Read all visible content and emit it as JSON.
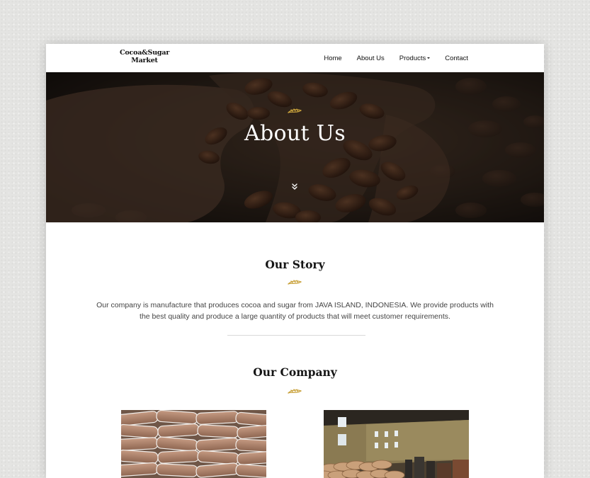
{
  "brand": {
    "logo_line1": "Cocoa&Sugar",
    "logo_line2": "Market"
  },
  "nav": {
    "items": [
      {
        "label": "Home"
      },
      {
        "label": "About Us"
      },
      {
        "label": "Products"
      },
      {
        "label": "Contact"
      }
    ]
  },
  "hero": {
    "title": "About Us",
    "ornament_icon": "wheat-ornament-icon",
    "scroll_icon": "double-chevron-down-icon"
  },
  "story": {
    "title": "Our Story",
    "text": "Our company is manufacture that produces cocoa and sugar from JAVA ISLAND, INDONESIA. We provide products with the best quality and produce a large quantity of products that will meet customer requirements."
  },
  "company": {
    "title": "Our Company",
    "photos": [
      {
        "icon": "stacked-sacks-photo"
      },
      {
        "icon": "warehouse-photo"
      }
    ]
  },
  "colors": {
    "accent_gold": "#c9a23c",
    "text_dark": "#151515",
    "text_body": "#444444",
    "page_background": "#e4e4e2"
  }
}
